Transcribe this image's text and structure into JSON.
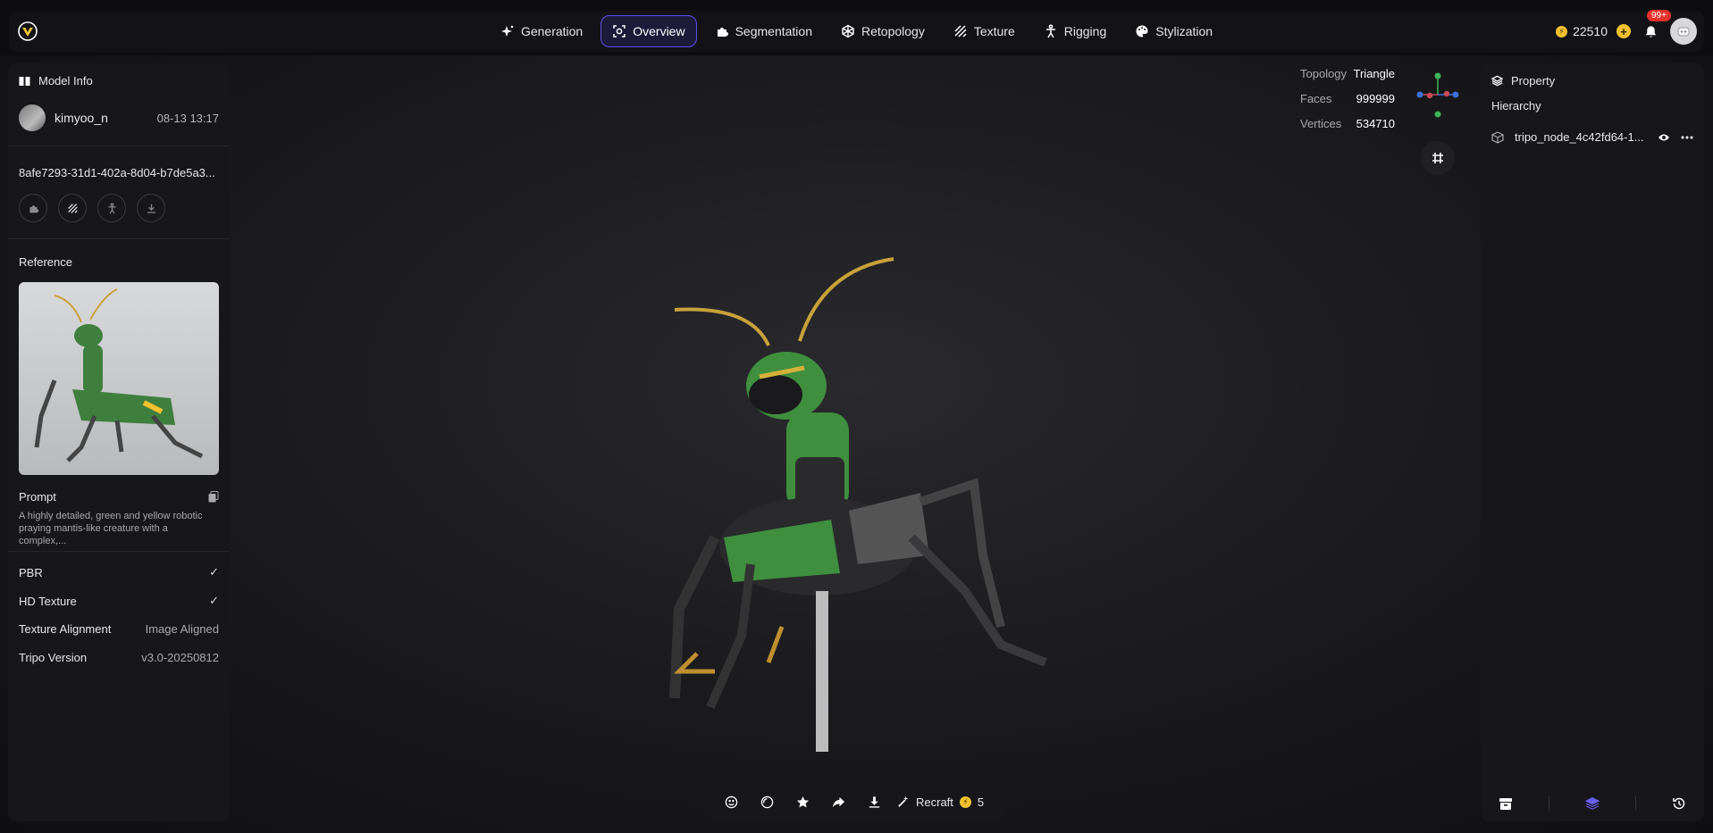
{
  "topbar": {
    "nav": [
      {
        "label": "Generation",
        "icon": "sparkle-icon",
        "active": false
      },
      {
        "label": "Overview",
        "icon": "scan-icon",
        "active": true
      },
      {
        "label": "Segmentation",
        "icon": "puzzle-icon",
        "active": false
      },
      {
        "label": "Retopology",
        "icon": "mesh-icon",
        "active": false
      },
      {
        "label": "Texture",
        "icon": "texture-icon",
        "active": false
      },
      {
        "label": "Rigging",
        "icon": "figure-icon",
        "active": false
      },
      {
        "label": "Stylization",
        "icon": "palette-icon",
        "active": false
      }
    ],
    "credits": "22510",
    "notification_badge": "99+"
  },
  "left_panel": {
    "title": "Model Info",
    "user": {
      "name": "kimyoo_n",
      "date": "08-13 13:17"
    },
    "model_id": "8afe7293-31d1-402a-8d04-b7de5a3...",
    "reference_label": "Reference",
    "prompt_label": "Prompt",
    "prompt_text": "A highly detailed, green and yellow robotic praying mantis-like creature with a complex,...",
    "properties": [
      {
        "key": "PBR",
        "value": "✓"
      },
      {
        "key": "HD Texture",
        "value": "✓"
      },
      {
        "key": "Texture Alignment",
        "value": "Image Aligned"
      },
      {
        "key": "Tripo Version",
        "value": "v3.0-20250812"
      }
    ]
  },
  "stats": {
    "topology": {
      "label": "Topology",
      "value": "Triangle"
    },
    "faces": {
      "label": "Faces",
      "value": "999999"
    },
    "vertices": {
      "label": "Vertices",
      "value": "534710"
    }
  },
  "right_panel": {
    "title": "Property",
    "hierarchy_label": "Hierarchy",
    "node_name": "tripo_node_4c42fd64-1..."
  },
  "toolbar": {
    "recraft_label": "Recraft",
    "recraft_cost": "5"
  },
  "colors": {
    "accent": "#5b4ee6",
    "coin": "#f2c12e",
    "badge": "#e5322d",
    "mantis_green": "#3f8f3e"
  }
}
